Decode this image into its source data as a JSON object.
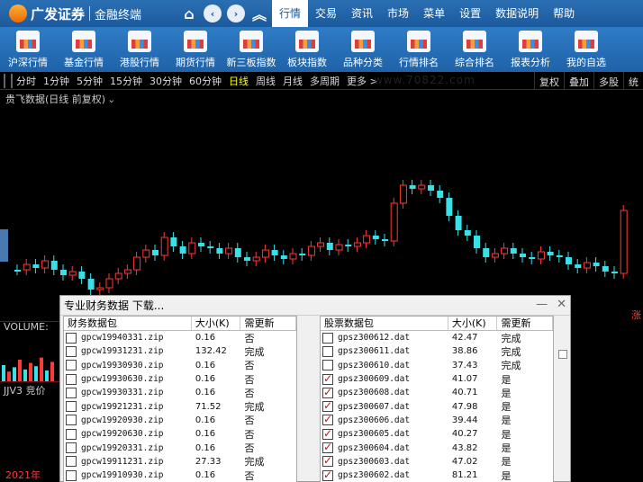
{
  "app": {
    "brand": "广发证券",
    "product": "金融终端"
  },
  "menu": [
    "行情",
    "交易",
    "资讯",
    "市场",
    "菜单",
    "设置",
    "数据说明",
    "帮助"
  ],
  "toolbar": [
    "沪深行情",
    "基金行情",
    "港股行情",
    "期货行情",
    "新三板指数",
    "板块指数",
    "品种分类",
    "行情排名",
    "综合排名",
    "报表分析",
    "我的自选"
  ],
  "periods": [
    "分时",
    "1分钟",
    "5分钟",
    "15分钟",
    "30分钟",
    "60分钟",
    "日线",
    "周线",
    "月线",
    "多周期",
    "更多 >"
  ],
  "period_active": "日线",
  "period_right": [
    "复权",
    "叠加",
    "多股",
    "统"
  ],
  "watermark": "www.70822.com",
  "chart": {
    "title": "贵飞数据(日线 前复权)",
    "price_tag": "涨",
    "year": "2021年"
  },
  "volume_label": "VOLUME:",
  "indicator_label": "JJV3 竞价",
  "dialog": {
    "title": "专业财务数据 下载...",
    "left_headers": [
      "财务数据包",
      "大小(K)",
      "需更新"
    ],
    "right_headers": [
      "股票数据包",
      "大小(K)",
      "需更新"
    ],
    "left_rows": [
      {
        "name": "gpcw19940331.zip",
        "size": "0.16",
        "status": "否",
        "checked": false
      },
      {
        "name": "gpcw19931231.zip",
        "size": "132.42",
        "status": "完成",
        "checked": false
      },
      {
        "name": "gpcw19930930.zip",
        "size": "0.16",
        "status": "否",
        "checked": false
      },
      {
        "name": "gpcw19930630.zip",
        "size": "0.16",
        "status": "否",
        "checked": false
      },
      {
        "name": "gpcw19930331.zip",
        "size": "0.16",
        "status": "否",
        "checked": false
      },
      {
        "name": "gpcw19921231.zip",
        "size": "71.52",
        "status": "完成",
        "checked": false
      },
      {
        "name": "gpcw19920930.zip",
        "size": "0.16",
        "status": "否",
        "checked": false
      },
      {
        "name": "gpcw19920630.zip",
        "size": "0.16",
        "status": "否",
        "checked": false
      },
      {
        "name": "gpcw19920331.zip",
        "size": "0.16",
        "status": "否",
        "checked": false
      },
      {
        "name": "gpcw19911231.zip",
        "size": "27.33",
        "status": "完成",
        "checked": false
      },
      {
        "name": "gpcw19910930.zip",
        "size": "0.16",
        "status": "否",
        "checked": false
      }
    ],
    "right_rows": [
      {
        "name": "gpsz300612.dat",
        "size": "42.47",
        "status": "完成",
        "checked": false
      },
      {
        "name": "gpsz300611.dat",
        "size": "38.86",
        "status": "完成",
        "checked": false
      },
      {
        "name": "gpsz300610.dat",
        "size": "37.43",
        "status": "完成",
        "checked": false
      },
      {
        "name": "gpsz300609.dat",
        "size": "41.07",
        "status": "是",
        "checked": true
      },
      {
        "name": "gpsz300608.dat",
        "size": "40.71",
        "status": "是",
        "checked": true
      },
      {
        "name": "gpsz300607.dat",
        "size": "47.98",
        "status": "是",
        "checked": true
      },
      {
        "name": "gpsz300606.dat",
        "size": "39.44",
        "status": "是",
        "checked": true
      },
      {
        "name": "gpsz300605.dat",
        "size": "40.27",
        "status": "是",
        "checked": true
      },
      {
        "name": "gpsz300604.dat",
        "size": "43.82",
        "status": "是",
        "checked": true
      },
      {
        "name": "gpsz300603.dat",
        "size": "47.02",
        "status": "是",
        "checked": true
      },
      {
        "name": "gpsz300602.dat",
        "size": "81.21",
        "status": "是",
        "checked": true
      }
    ]
  },
  "colors": {
    "up": "#ff3838",
    "down": "#38e0e8",
    "bg": "#000000",
    "accent": "#1b5a9c"
  }
}
